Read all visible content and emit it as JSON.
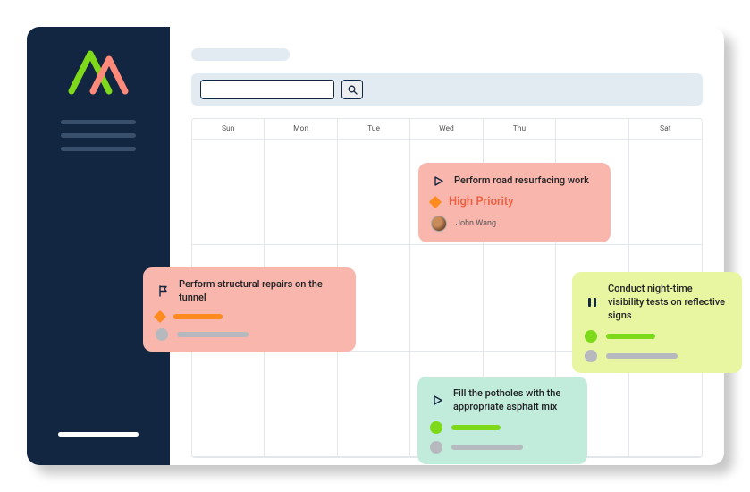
{
  "search": {
    "placeholder": ""
  },
  "calendar": {
    "days": [
      "Sun",
      "Mon",
      "Tue",
      "Wed",
      "Thu",
      "",
      "Sat"
    ]
  },
  "events": {
    "resurface": {
      "title": "Perform road resurfacing work",
      "priority": "High Priority",
      "assignee": "John Wang"
    },
    "tunnel": {
      "title": "Perform structural repairs on the tunnel"
    },
    "visibility": {
      "title": "Conduct night-time visibility tests on reflective signs"
    },
    "potholes": {
      "title": "Fill the potholes with the appropriate asphalt mix"
    }
  }
}
